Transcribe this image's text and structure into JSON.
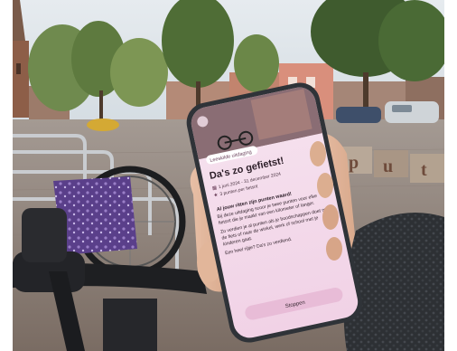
{
  "photo": {
    "subject": "hand holding smartphone in town square with bicycles",
    "sky_color": "#dfe6ec",
    "pavement_color": "#8c7f76",
    "sweater_color": "#2e3135",
    "phone_frame_color": "#3a3e44"
  },
  "phone_screen": {
    "badge": "Leeskilde uitdaging",
    "title": "Da's zo gefietst!",
    "date_range": "1 juni 2024 - 31 december 2024",
    "points": "3 punten per fietsrit",
    "section_heading": "Al jouw ritten zijn punten waard!",
    "body_1": "Bij deze uitdaging scoor je twee punten voor elke fietsrit die je maakt van een kilometer of langer.",
    "body_2": "Zo verdien je al punten als je boodschappen doet met de fiets of naar de winkel, werk of school met je kinderen gaat.",
    "body_3": "Een heel rijtje? Da's zo verdiend.",
    "button_label": "Stoppen",
    "accent_color": "#f3d6ea"
  },
  "street_letters": [
    "p",
    "u",
    "t"
  ]
}
